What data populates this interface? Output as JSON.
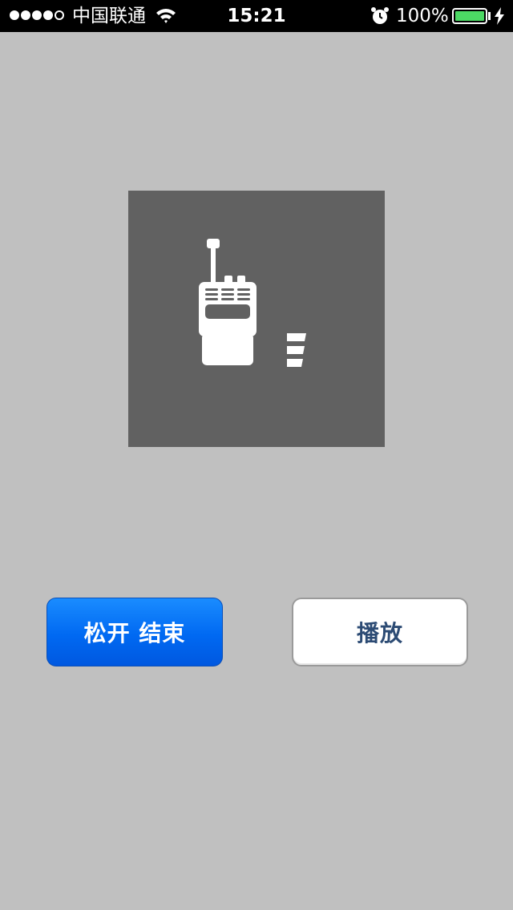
{
  "status_bar": {
    "signal_dots_filled": 4,
    "signal_dots_total": 5,
    "carrier": "中国联通",
    "time": "15:21",
    "battery_percent": "100%",
    "battery_level": 1.0,
    "battery_color": "#4cd964",
    "icons": [
      "wifi-icon",
      "alarm-clock-icon",
      "battery-icon",
      "charging-bolt-icon"
    ]
  },
  "record_panel": {
    "background": "#616161",
    "icons": [
      "walkie-talkie-icon",
      "volume-level-icon"
    ],
    "volume_bars_shown": 3
  },
  "buttons": {
    "release_end_label": "松开 结束",
    "play_label": "播放"
  },
  "colors": {
    "page_background": "#c0c0c0",
    "primary_button": "#0069f2",
    "secondary_button_text": "#2c4b74"
  }
}
